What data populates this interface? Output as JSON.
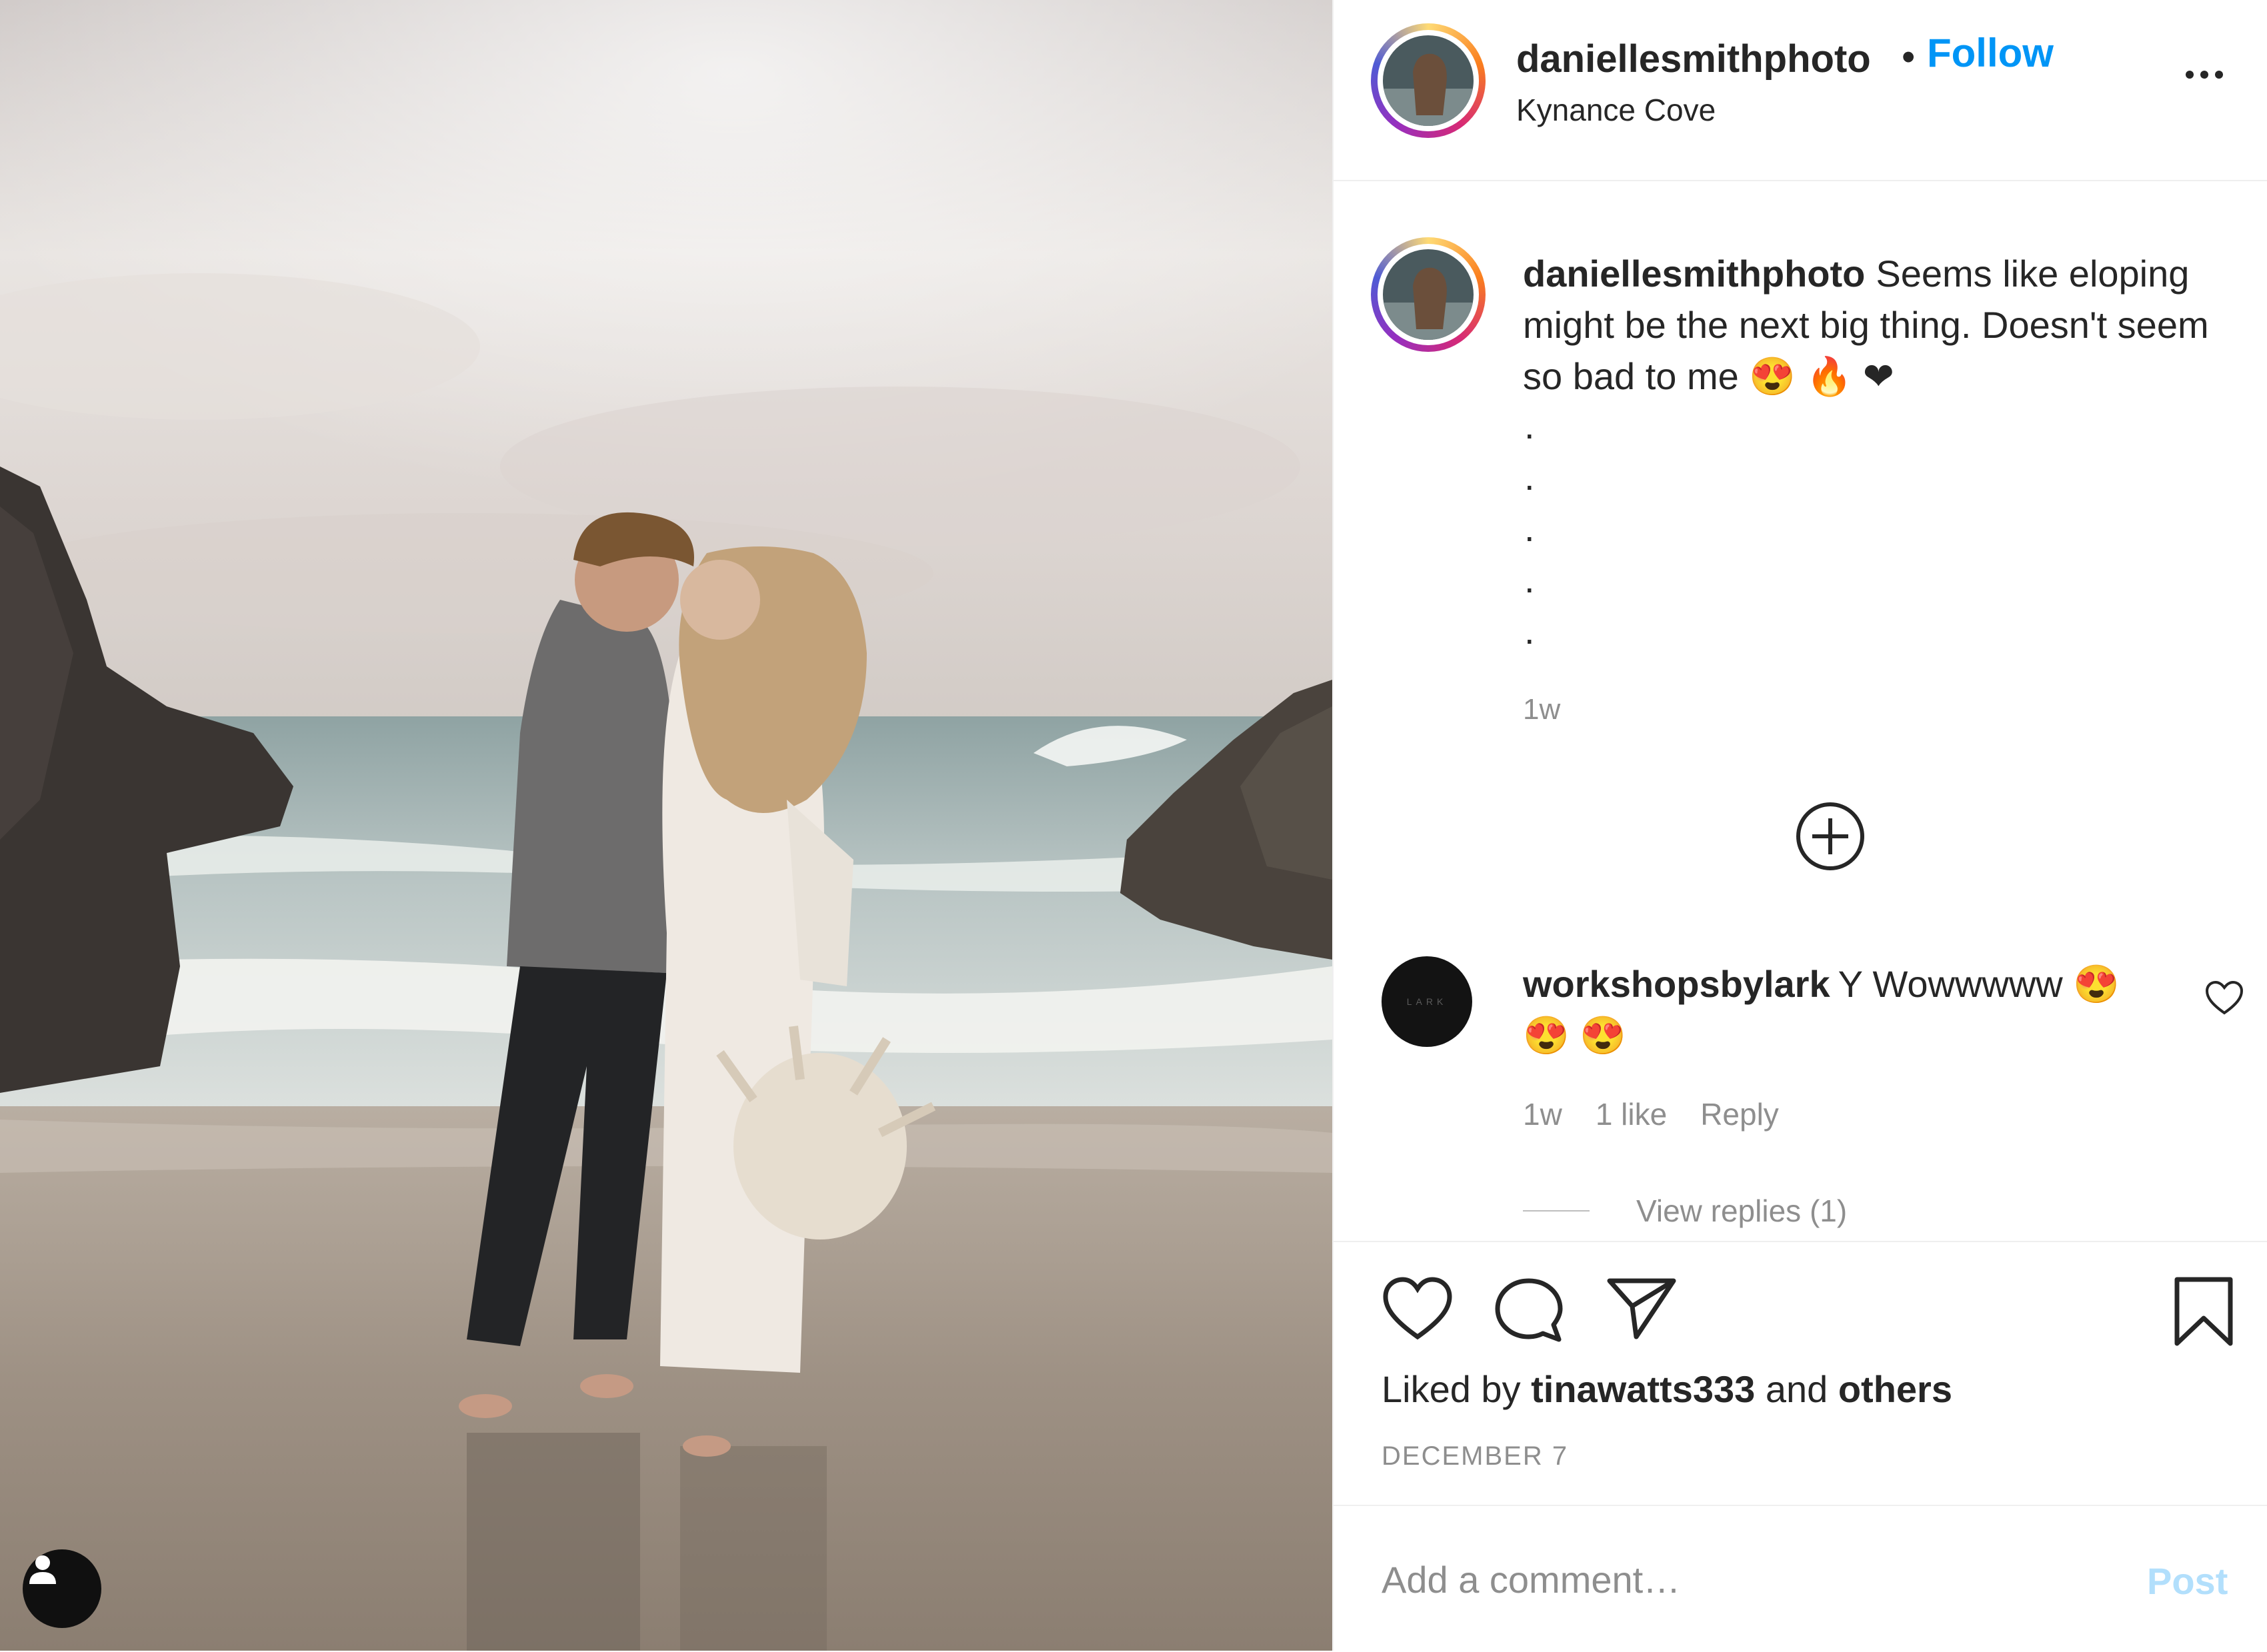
{
  "post": {
    "author": "daniellesmithphoto",
    "separator": "•",
    "follow_label": "Follow",
    "location": "Kynance Cove"
  },
  "caption": {
    "username": "daniellesmithphoto",
    "text": "Seems like eloping might be the next big thing. Doesn't seem so bad to me 😍 🔥 ❤",
    "dots": [
      ".",
      " .",
      ".",
      ".",
      "."
    ],
    "time": "1w"
  },
  "comment": {
    "username": "workshopsbylark",
    "text": "Y Wowwwww 😍 😍 😍",
    "avatar_text": "LARK",
    "time": "1w",
    "likes": "1 like",
    "reply_label": "Reply",
    "view_replies": "View replies (1)"
  },
  "actions": {
    "liked_prefix": "Liked by",
    "liked_user": "tinawatts333",
    "liked_and": "and",
    "liked_others": "others",
    "date": "DECEMBER 7"
  },
  "comment_bar": {
    "placeholder": "Add a comment…",
    "post_label": "Post"
  },
  "colors": {
    "follow": "#0095f6",
    "muted": "#8e8e8e",
    "post_disabled": "#b2dffc"
  },
  "icons": [
    "more-options-icon",
    "load-more-comments-icon",
    "heart-icon",
    "comment-icon",
    "share-icon",
    "save-icon",
    "user-tag-icon",
    "comment-like-icon"
  ]
}
